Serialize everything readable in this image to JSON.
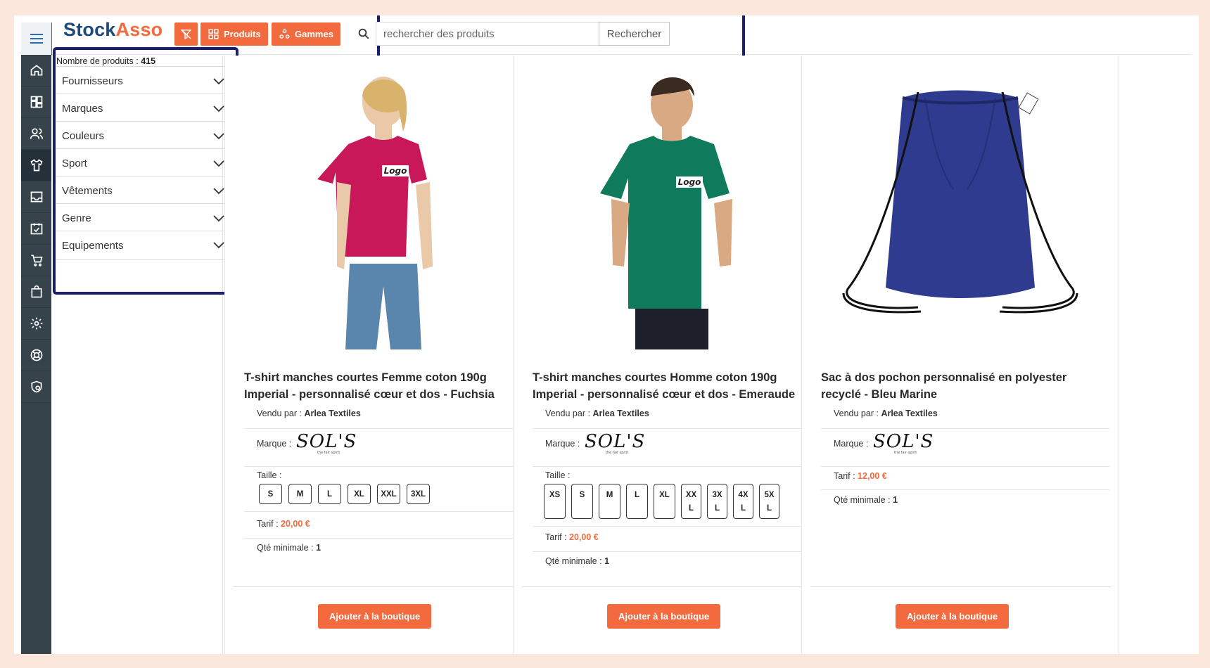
{
  "app": {
    "logo_part1": "Stock",
    "logo_part2": "Asso",
    "accent_color": "#f26a3d",
    "brand_color": "#1d4a7a"
  },
  "toolbar": {
    "filter_icon": "filter-off-icon",
    "products_label": "Produits",
    "ranges_label": "Gammes"
  },
  "search": {
    "placeholder": "rechercher des produits",
    "button_label": "Rechercher"
  },
  "rail": {
    "items": [
      {
        "icon": "home-icon"
      },
      {
        "icon": "dashboard-icon"
      },
      {
        "icon": "users-icon"
      },
      {
        "icon": "tshirt-icon",
        "active": true
      },
      {
        "icon": "inbox-icon"
      },
      {
        "icon": "calendar-check-icon"
      },
      {
        "icon": "cart-icon"
      },
      {
        "icon": "bag-icon"
      },
      {
        "icon": "settings-icon"
      },
      {
        "icon": "support-icon"
      },
      {
        "icon": "shield-icon"
      }
    ]
  },
  "filters": {
    "count_label": "Nombre de produits :",
    "count_value": "415",
    "items": [
      {
        "label": "Fournisseurs"
      },
      {
        "label": "Marques"
      },
      {
        "label": "Couleurs"
      },
      {
        "label": "Sport"
      },
      {
        "label": "Vêtements"
      },
      {
        "label": "Genre"
      },
      {
        "label": "Equipements"
      }
    ]
  },
  "labels": {
    "sold_by": "Vendu par :",
    "brand": "Marque :",
    "size": "Taille :",
    "price": "Tarif :",
    "min_qty": "Qté minimale :",
    "add_button": "Ajouter à la boutique"
  },
  "products": [
    {
      "title": "T-shirt manches courtes Femme coton 190g Imperial - personnalisé cœur et dos - Fuchsia",
      "seller": "Arlea Textiles",
      "brand_logo_text": "SOL'S",
      "brand_logo_tagline": "the fair spirit",
      "sizes": [
        "S",
        "M",
        "L",
        "XL",
        "XXL",
        "3XL"
      ],
      "price": "20,00 €",
      "min_qty": "1",
      "image_color": "#c8185a",
      "logo_print": "Logo"
    },
    {
      "title": "T-shirt manches courtes Homme coton 190g Imperial - personnalisé cœur et dos - Emeraude",
      "seller": "Arlea Textiles",
      "brand_logo_text": "SOL'S",
      "brand_logo_tagline": "the fair spirit",
      "sizes": [
        "XS",
        "S",
        "M",
        "L",
        "XL",
        "XX L",
        "3X L",
        "4X L",
        "5X L"
      ],
      "price": "20,00 €",
      "min_qty": "1",
      "image_color": "#0f7a5c",
      "logo_print": "Logo"
    },
    {
      "title": "Sac à dos pochon personnalisé en polyester recyclé - Bleu Marine",
      "seller": "Arlea Textiles",
      "brand_logo_text": "SOL'S",
      "brand_logo_tagline": "the fair spirit",
      "price": "12,00 €",
      "min_qty": "1",
      "image_color": "#2e3b8f"
    }
  ]
}
